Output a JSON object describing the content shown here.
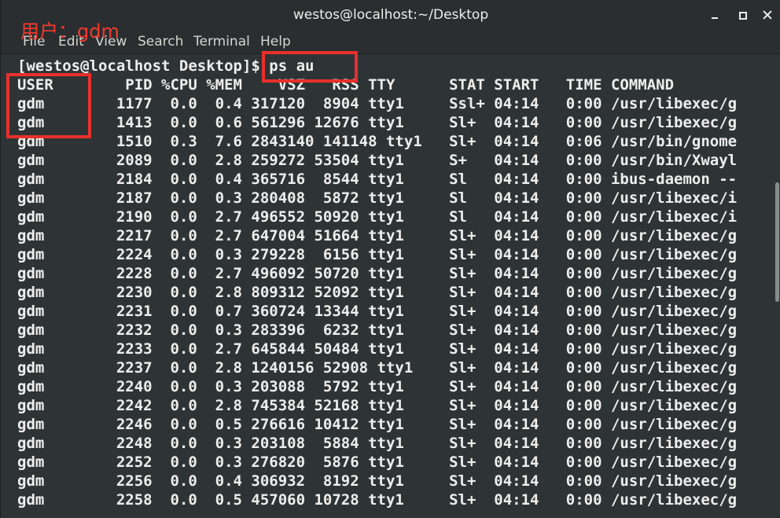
{
  "window": {
    "title": "westos@localhost:~/Desktop"
  },
  "menubar": {
    "items": [
      "File",
      "Edit",
      "View",
      "Search",
      "Terminal",
      "Help"
    ]
  },
  "annotation": {
    "label": "用户：gdm",
    "color": "#e8302c"
  },
  "terminal": {
    "prompt": "[westos@localhost Desktop]$ ps au",
    "header": "USER        PID %CPU %MEM    VSZ   RSS TTY      STAT START   TIME COMMAND",
    "rows": [
      "gdm        1177  0.0  0.4 317120  8904 tty1     Ssl+ 04:14   0:00 /usr/libexec/g",
      "gdm        1413  0.0  0.6 561296 12676 tty1     Sl+  04:14   0:00 /usr/libexec/g",
      "gdm        1510  0.3  7.6 2843140 141148 tty1   Sl+  04:14   0:06 /usr/bin/gnome",
      "gdm        2089  0.0  2.8 259272 53504 tty1     S+   04:14   0:00 /usr/bin/Xwayl",
      "gdm        2184  0.0  0.4 365716  8544 tty1     Sl   04:14   0:00 ibus-daemon --",
      "gdm        2187  0.0  0.3 280408  5872 tty1     Sl   04:14   0:00 /usr/libexec/i",
      "gdm        2190  0.0  2.7 496552 50920 tty1     Sl   04:14   0:00 /usr/libexec/i",
      "gdm        2217  0.0  2.7 647004 51664 tty1     Sl+  04:14   0:00 /usr/libexec/g",
      "gdm        2224  0.0  0.3 279228  6156 tty1     Sl+  04:14   0:00 /usr/libexec/g",
      "gdm        2228  0.0  2.7 496092 50720 tty1     Sl+  04:14   0:00 /usr/libexec/g",
      "gdm        2230  0.0  2.8 809312 52092 tty1     Sl+  04:14   0:00 /usr/libexec/g",
      "gdm        2231  0.0  0.7 360724 13344 tty1     Sl+  04:14   0:00 /usr/libexec/g",
      "gdm        2232  0.0  0.3 283396  6232 tty1     Sl+  04:14   0:00 /usr/libexec/g",
      "gdm        2233  0.0  2.7 645844 50484 tty1     Sl+  04:14   0:00 /usr/libexec/g",
      "gdm        2237  0.0  2.8 1240156 52908 tty1    Sl+  04:14   0:00 /usr/libexec/g",
      "gdm        2240  0.0  0.3 203088  5792 tty1     Sl+  04:14   0:00 /usr/libexec/g",
      "gdm        2242  0.0  2.8 745384 52168 tty1     Sl+  04:14   0:00 /usr/libexec/g",
      "gdm        2246  0.0  0.5 276616 10412 tty1     Sl+  04:14   0:00 /usr/libexec/g",
      "gdm        2248  0.0  0.3 203108  5884 tty1     Sl+  04:14   0:00 /usr/libexec/g",
      "gdm        2252  0.0  0.3 276820  5876 tty1     Sl+  04:14   0:00 /usr/libexec/g",
      "gdm        2256  0.0  0.4 306932  8192 tty1     Sl+  04:14   0:00 /usr/libexec/g",
      "gdm        2258  0.0  0.5 457060 10728 tty1     Sl+  04:14   0:00 /usr/libexec/g"
    ]
  }
}
